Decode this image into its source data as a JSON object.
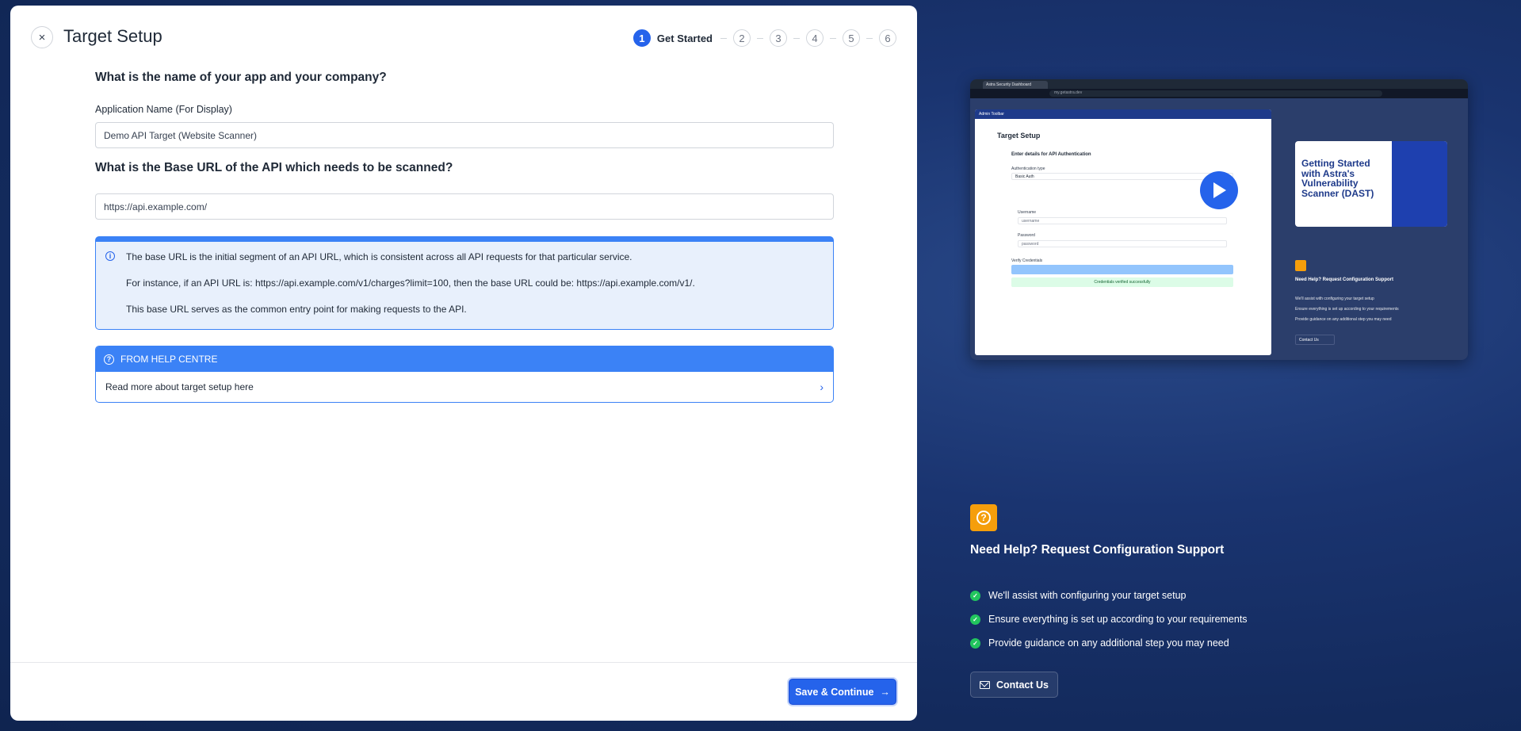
{
  "modal": {
    "close_glyph": "×",
    "title": "Target Setup",
    "stepper": {
      "active_step": "1",
      "active_label": "Get Started",
      "other_steps": [
        "2",
        "3",
        "4",
        "5",
        "6"
      ]
    },
    "q1_heading": "What is the name of your app and your company?",
    "app_name_label": "Application Name (For Display)",
    "app_name_value": "Demo API Target (Website Scanner)",
    "q2_heading": "What is the Base URL of the API which needs to be scanned?",
    "base_url_value": "https://api.example.com/",
    "info": {
      "icon_glyph": "i",
      "line1": "The base URL is the initial segment of an API URL, which is consistent across all API requests for that particular service.",
      "line2": "For instance, if an API URL is: https://api.example.com/v1/charges?limit=100, then the base URL could be: https://api.example.com/v1/.",
      "line3": "This base URL serves as the common entry point for making requests to the API."
    },
    "help_centre": {
      "header": "FROM HELP CENTRE",
      "link_text": "Read more about target setup here",
      "chevron_glyph": "›"
    },
    "save_button": "Save & Continue",
    "save_arrow": "→"
  },
  "preview": {
    "tab_label": "Astra Security Dashboard",
    "url": "my.getastra.dev",
    "admin_toolbar": "Admin Toolbar",
    "window_title": "Target Setup",
    "section_title": "Enter details for API Authentication",
    "auth_type_label": "Authentication type",
    "auth_type_value": "Basic Auth",
    "username_label": "Username",
    "username_placeholder": "username",
    "password_label": "Password",
    "password_placeholder": "password",
    "verify_label": "Verify Credentials",
    "verified_text": "Credentials verified successfully",
    "thumb_title": "Getting Started with Astra's Vulnerability Scanner (DAST)",
    "mini_heading": "Need Help? Request Configuration Support",
    "mini_items": [
      "We'll assist with configuring your target setup",
      "Ensure everything is set up according to your requirements",
      "Provide guidance on any additional step you may need"
    ],
    "mini_contact": "Contact Us"
  },
  "right_panel": {
    "help_glyph": "?",
    "heading": "Need Help? Request Configuration Support",
    "check_glyph": "✓",
    "items": [
      "We'll assist with configuring your target setup",
      "Ensure everything is set up according to your requirements",
      "Provide guidance on any additional step you may need"
    ],
    "contact_button": "Contact Us"
  },
  "colors": {
    "accent": "#2563eb",
    "info_bg": "#e8f0fc",
    "help_icon_bg": "#f59e0b",
    "check_green": "#22c55e",
    "backdrop": "#1a3470"
  }
}
